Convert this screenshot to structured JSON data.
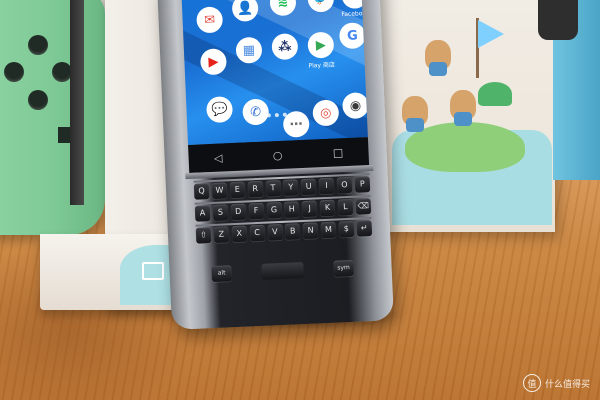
{
  "scene": {
    "description_tags": [
      "blackberry-keyone-phone",
      "nintendo-switch-dock",
      "animal-crossing-box",
      "joy-con-controller",
      "wooden-table"
    ],
    "colors": {
      "table": "#c9843f",
      "joycon": "#8fd5a5",
      "screen": "#1a6fd3",
      "box_sea": "#a9dde4"
    }
  },
  "phone": {
    "apps": [
      {
        "id": "gmail",
        "glyph": "✉",
        "color": "#e04b3c",
        "label": ""
      },
      {
        "id": "contacts",
        "glyph": "👤",
        "color": "#2f6fd6",
        "label": ""
      },
      {
        "id": "spotify",
        "glyph": "≋",
        "color": "#1db954",
        "label": ""
      },
      {
        "id": "twitter",
        "glyph": "🐦",
        "color": "#1da1f2",
        "label": ""
      },
      {
        "id": "facebook",
        "glyph": "f",
        "color": "#3b5998",
        "label": "Facebook"
      },
      {
        "id": "youtube",
        "glyph": "▶",
        "color": "#e62117",
        "label": ""
      },
      {
        "id": "calculator",
        "glyph": "▦",
        "color": "#4a8be0",
        "label": ""
      },
      {
        "id": "blackberry",
        "glyph": "⁂",
        "color": "#1a2e66",
        "label": ""
      },
      {
        "id": "play",
        "glyph": "▶",
        "color": "#34a853",
        "label": "Play 商店"
      },
      {
        "id": "maps",
        "glyph": "G",
        "color": "#4285f4",
        "label": ""
      },
      {
        "id": "messages",
        "glyph": "💬",
        "color": "#1a2e66",
        "label": ""
      },
      {
        "id": "phone",
        "glyph": "✆",
        "color": "#2f6fd6",
        "label": ""
      },
      {
        "id": "apps",
        "glyph": "⋯",
        "color": "#666666",
        "label": ""
      },
      {
        "id": "chrome",
        "glyph": "◎",
        "color": "#e04b3c",
        "label": ""
      },
      {
        "id": "camera",
        "glyph": "◉",
        "color": "#3a3a3a",
        "label": ""
      }
    ],
    "nav": {
      "back": "◁",
      "home": "○",
      "recent": "□"
    },
    "keyboard_rows": [
      [
        "Q",
        "W",
        "E",
        "R",
        "T",
        "Y",
        "U",
        "I",
        "O",
        "P"
      ],
      [
        "A",
        "S",
        "D",
        "F",
        "G",
        "H",
        "J",
        "K",
        "L",
        "⌫"
      ],
      [
        "⇧",
        "Z",
        "X",
        "C",
        "V",
        "B",
        "N",
        "M",
        "$",
        "↵"
      ]
    ],
    "bottom_keys": [
      "alt",
      "sym"
    ]
  },
  "watermark": {
    "text": "什么值得买",
    "logo": "值"
  }
}
